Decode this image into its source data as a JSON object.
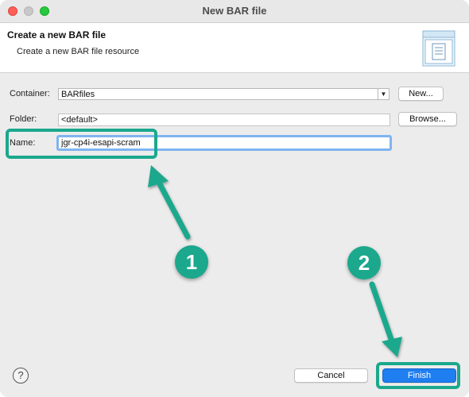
{
  "window": {
    "title": "New BAR file"
  },
  "banner": {
    "title": "Create a new BAR file",
    "description": "Create a new BAR file resource",
    "icon": "document-wizard-icon"
  },
  "form": {
    "container_label": "Container:",
    "container_value": "BARfiles",
    "container_new_button": "New...",
    "folder_label": "Folder:",
    "folder_value": "<default>",
    "folder_browse_button": "Browse...",
    "name_label": "Name:",
    "name_value": "jgr-cp4i-esapi-scram"
  },
  "footer": {
    "help_icon": "help-icon",
    "help_glyph": "?",
    "cancel_label": "Cancel",
    "finish_label": "Finish"
  },
  "annotations": {
    "step1": "1",
    "step2": "2",
    "color": "#1ba88d"
  }
}
